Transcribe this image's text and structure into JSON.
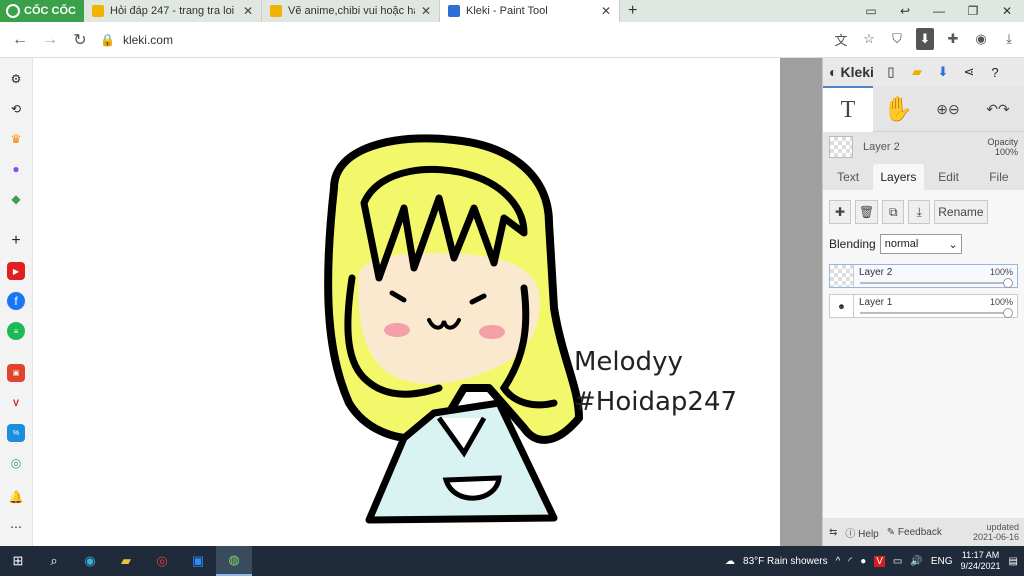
{
  "browser": {
    "brand": "CỐC CỐC",
    "tabs": [
      {
        "title": "Hỏi đáp 247 - trang tra loi",
        "favicon_color": "#f0b400"
      },
      {
        "title": "Vẽ anime,chibi vui hoặc hạnh",
        "favicon_color": "#f0b400"
      },
      {
        "title": "Kleki - Paint Tool",
        "favicon_color": "#2b6fd6"
      }
    ],
    "url": "kleki.com"
  },
  "kleki": {
    "logo": "Kleki",
    "tool_text": "T",
    "layer_name": "Layer 2",
    "opacity_label": "Opacity",
    "opacity_value": "100%",
    "tabs": [
      "Text",
      "Layers",
      "Edit",
      "File"
    ],
    "rename": "Rename",
    "blending_label": "Blending",
    "blending_value": "normal",
    "layers": [
      {
        "name": "Layer 2",
        "opacity": "100%"
      },
      {
        "name": "Layer 1",
        "opacity": "100%"
      }
    ],
    "help": "Help",
    "feedback": "Feedback",
    "updated": "updated",
    "updated_date": "2021-06-16"
  },
  "canvas": {
    "text_line1": "Melodyy",
    "text_line2": "#Hoidap247"
  },
  "taskbar": {
    "weather": "83°F  Rain showers",
    "lang": "ENG",
    "time": "11:17 AM",
    "date": "9/24/2021"
  }
}
